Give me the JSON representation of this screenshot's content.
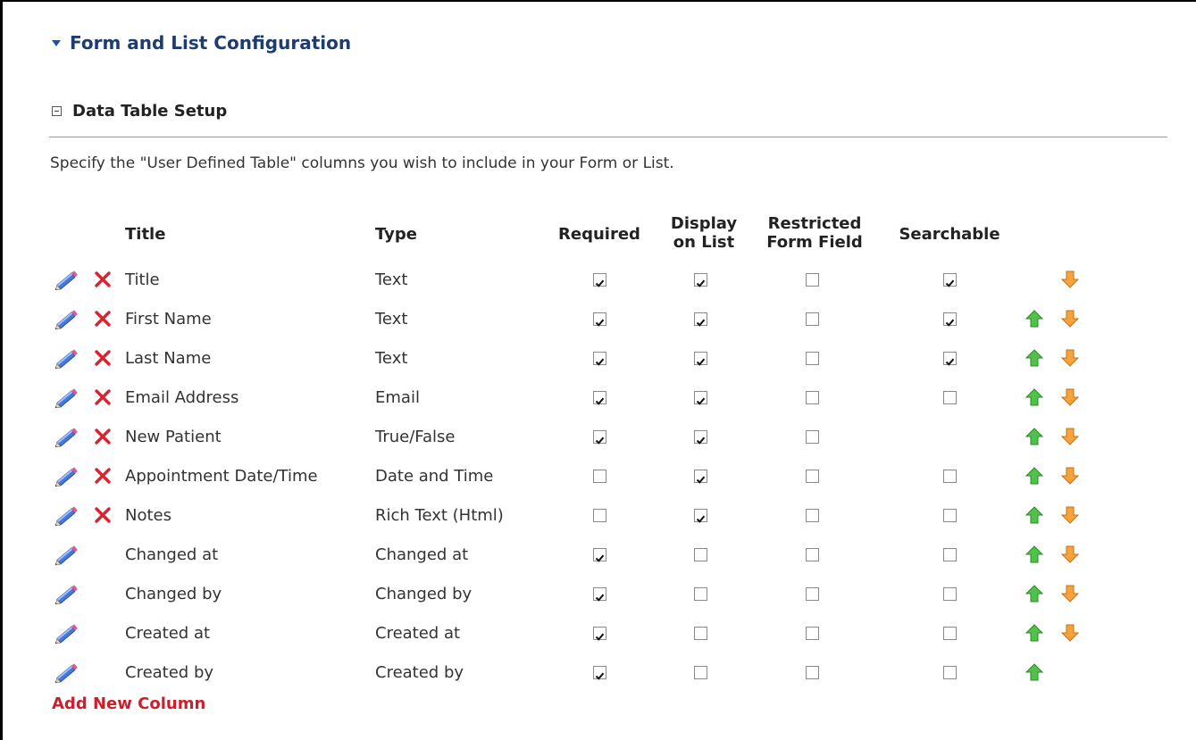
{
  "section": {
    "title": "Form and List Configuration"
  },
  "subsection": {
    "title": "Data Table Setup"
  },
  "description": "Specify the \"User Defined Table\" columns you wish to include in your Form or List.",
  "headers": {
    "title": "Title",
    "type": "Type",
    "required": "Required",
    "display_line1": "Display",
    "display_line2": "on List",
    "restricted_line1": "Restricted",
    "restricted_line2": "Form Field",
    "searchable": "Searchable"
  },
  "rows": [
    {
      "title": "Title",
      "type": "Text",
      "deletable": true,
      "required": true,
      "display": true,
      "restricted": false,
      "searchable": true,
      "has_searchable": true,
      "up": false,
      "down": true
    },
    {
      "title": "First Name",
      "type": "Text",
      "deletable": true,
      "required": true,
      "display": true,
      "restricted": false,
      "searchable": true,
      "has_searchable": true,
      "up": true,
      "down": true
    },
    {
      "title": "Last Name",
      "type": "Text",
      "deletable": true,
      "required": true,
      "display": true,
      "restricted": false,
      "searchable": true,
      "has_searchable": true,
      "up": true,
      "down": true
    },
    {
      "title": "Email Address",
      "type": "Email",
      "deletable": true,
      "required": true,
      "display": true,
      "restricted": false,
      "searchable": false,
      "has_searchable": true,
      "up": true,
      "down": true
    },
    {
      "title": "New Patient",
      "type": "True/False",
      "deletable": true,
      "required": true,
      "display": true,
      "restricted": false,
      "searchable": false,
      "has_searchable": false,
      "up": true,
      "down": true
    },
    {
      "title": "Appointment Date/Time",
      "type": "Date and Time",
      "deletable": true,
      "required": false,
      "display": true,
      "restricted": false,
      "searchable": false,
      "has_searchable": true,
      "up": true,
      "down": true
    },
    {
      "title": "Notes",
      "type": "Rich Text (Html)",
      "deletable": true,
      "required": false,
      "display": true,
      "restricted": false,
      "searchable": false,
      "has_searchable": true,
      "up": true,
      "down": true
    },
    {
      "title": "Changed at",
      "type": "Changed at",
      "deletable": false,
      "required": true,
      "display": false,
      "restricted": false,
      "searchable": false,
      "has_searchable": true,
      "up": true,
      "down": true
    },
    {
      "title": "Changed by",
      "type": "Changed by",
      "deletable": false,
      "required": true,
      "display": false,
      "restricted": false,
      "searchable": false,
      "has_searchable": true,
      "up": true,
      "down": true
    },
    {
      "title": "Created at",
      "type": "Created at",
      "deletable": false,
      "required": true,
      "display": false,
      "restricted": false,
      "searchable": false,
      "has_searchable": true,
      "up": true,
      "down": true
    },
    {
      "title": "Created by",
      "type": "Created by",
      "deletable": false,
      "required": true,
      "display": false,
      "restricted": false,
      "searchable": false,
      "has_searchable": true,
      "up": true,
      "down": false
    }
  ],
  "add_link": "Add New Column",
  "icons": {
    "edit": "pencil-icon",
    "delete": "red-x-icon",
    "up": "green-up-arrow-icon",
    "down": "orange-down-arrow-icon"
  },
  "colors": {
    "section_title": "#1e3c6e",
    "link": "#cc1f2b",
    "up_arrow": "#3a9a2a",
    "down_arrow": "#e8891c"
  }
}
